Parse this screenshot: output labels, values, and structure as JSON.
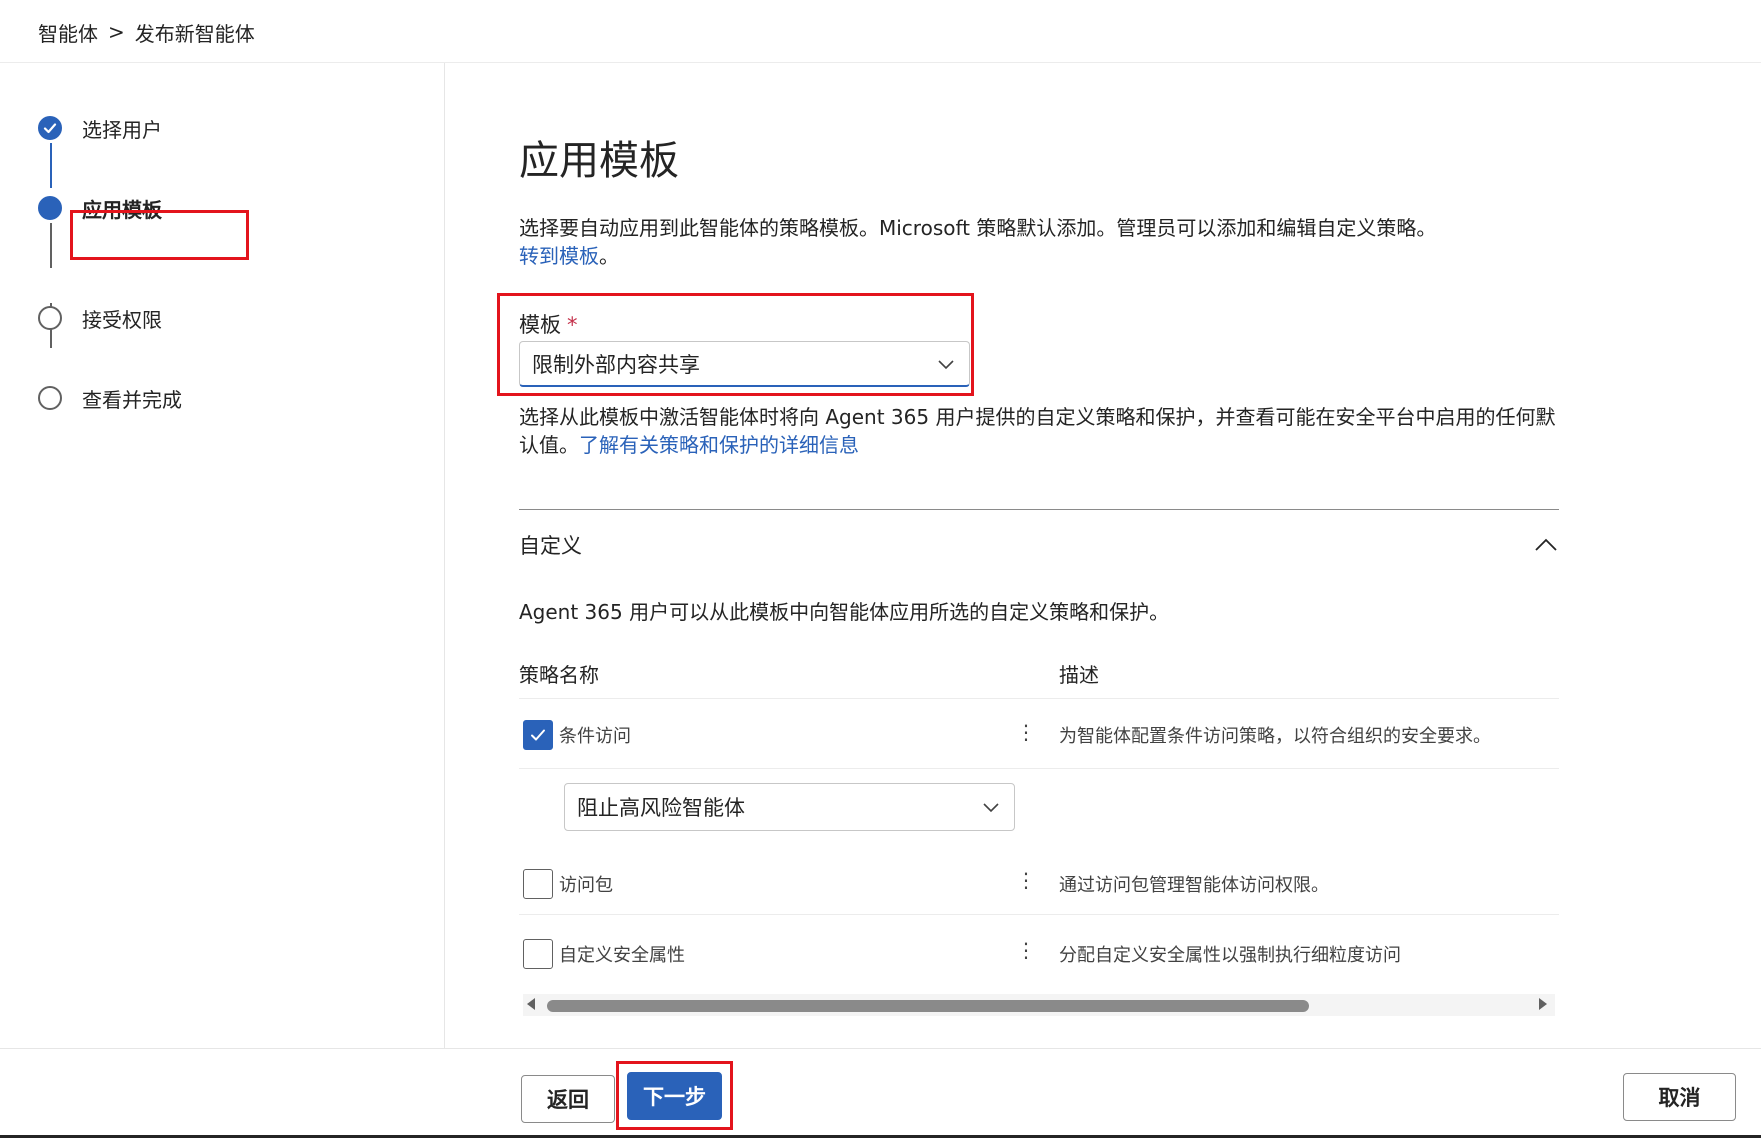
{
  "breadcrumb": {
    "parent": "智能体",
    "separator": ">",
    "current": "发布新智能体"
  },
  "steps": [
    {
      "label": "选择用户",
      "state": "completed"
    },
    {
      "label": "应用模板",
      "state": "current"
    },
    {
      "label": "接受权限",
      "state": "pending"
    },
    {
      "label": "查看并完成",
      "state": "pending"
    }
  ],
  "main": {
    "title": "应用模板",
    "description": "选择要自动应用到此智能体的策略模板。Microsoft 策略默认添加。管理员可以添加和编辑自定义策略。",
    "description_link": "转到模板",
    "description_end": "。",
    "template_label": "模板",
    "required_mark": "*",
    "template_value": "限制外部内容共享",
    "help_text": "选择从此模板中激活智能体时将向 Agent 365 用户提供的自定义策略和保护，并查看可能在安全平台中启用的任何默认值。",
    "help_link": "了解有关策略和保护的详细信息",
    "section_title": "自定义",
    "section_desc": "Agent 365 用户可以从此模板中向智能体应用所选的自定义策略和保护。"
  },
  "table": {
    "columns": [
      "策略名称",
      "描述"
    ],
    "rows": [
      {
        "name": "条件访问",
        "checked": true,
        "description": "为智能体配置条件访问策略，以符合组织的安全要求。",
        "option": "阻止高风险智能体"
      },
      {
        "name": "访问包",
        "checked": false,
        "description": "通过访问包管理智能体访问权限。"
      },
      {
        "name": "自定义安全属性",
        "checked": false,
        "description": "分配自定义安全属性以强制执行细粒度访问"
      }
    ],
    "more_glyph": "⋮"
  },
  "footer": {
    "back": "返回",
    "next": "下一步",
    "cancel": "取消"
  },
  "colors": {
    "accent": "#2a62b9",
    "highlight": "#e3141c"
  }
}
